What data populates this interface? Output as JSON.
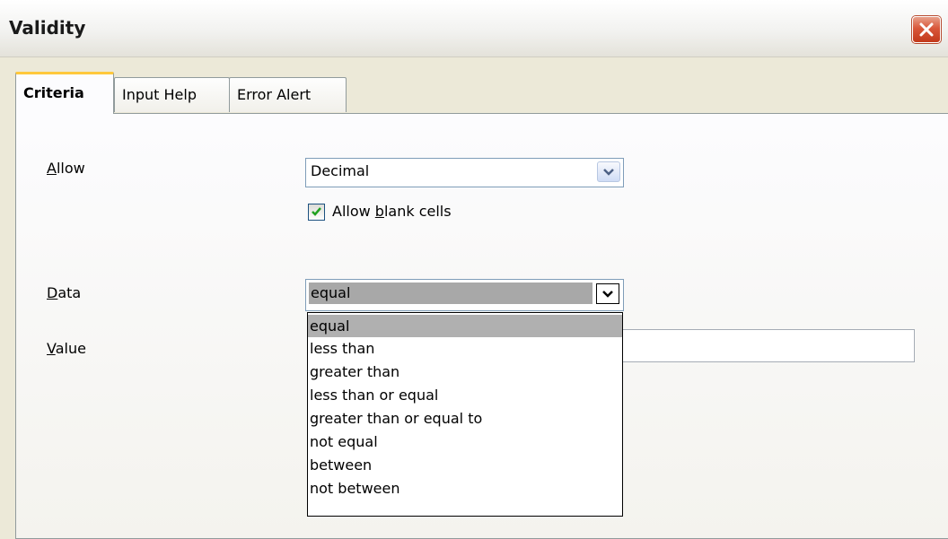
{
  "window": {
    "title": "Validity"
  },
  "tabs": [
    {
      "label": "Criteria",
      "active": true
    },
    {
      "label": "Input Help",
      "active": false
    },
    {
      "label": "Error Alert",
      "active": false
    }
  ],
  "criteria": {
    "allow_label_prefix": "",
    "allow_label_access": "A",
    "allow_label_rest": "llow",
    "allow_value": "Decimal",
    "allow_blank_label_pre": "Allow ",
    "allow_blank_label_access": "b",
    "allow_blank_label_post": "lank cells",
    "allow_blank_checked": true,
    "data_label_access": "D",
    "data_label_rest": "ata",
    "data_value": "equal",
    "value_label_access": "V",
    "value_label_rest": "alue",
    "value_input": ""
  },
  "data_options": [
    "equal",
    "less than",
    "greater than",
    "less than or equal",
    "greater than or equal to",
    "not equal",
    "between",
    "not between"
  ],
  "data_selected_index": 0,
  "colors": {
    "selection": "#b0b0b0",
    "tab_accent": "#ffc83c",
    "close_red": "#d9573a"
  }
}
